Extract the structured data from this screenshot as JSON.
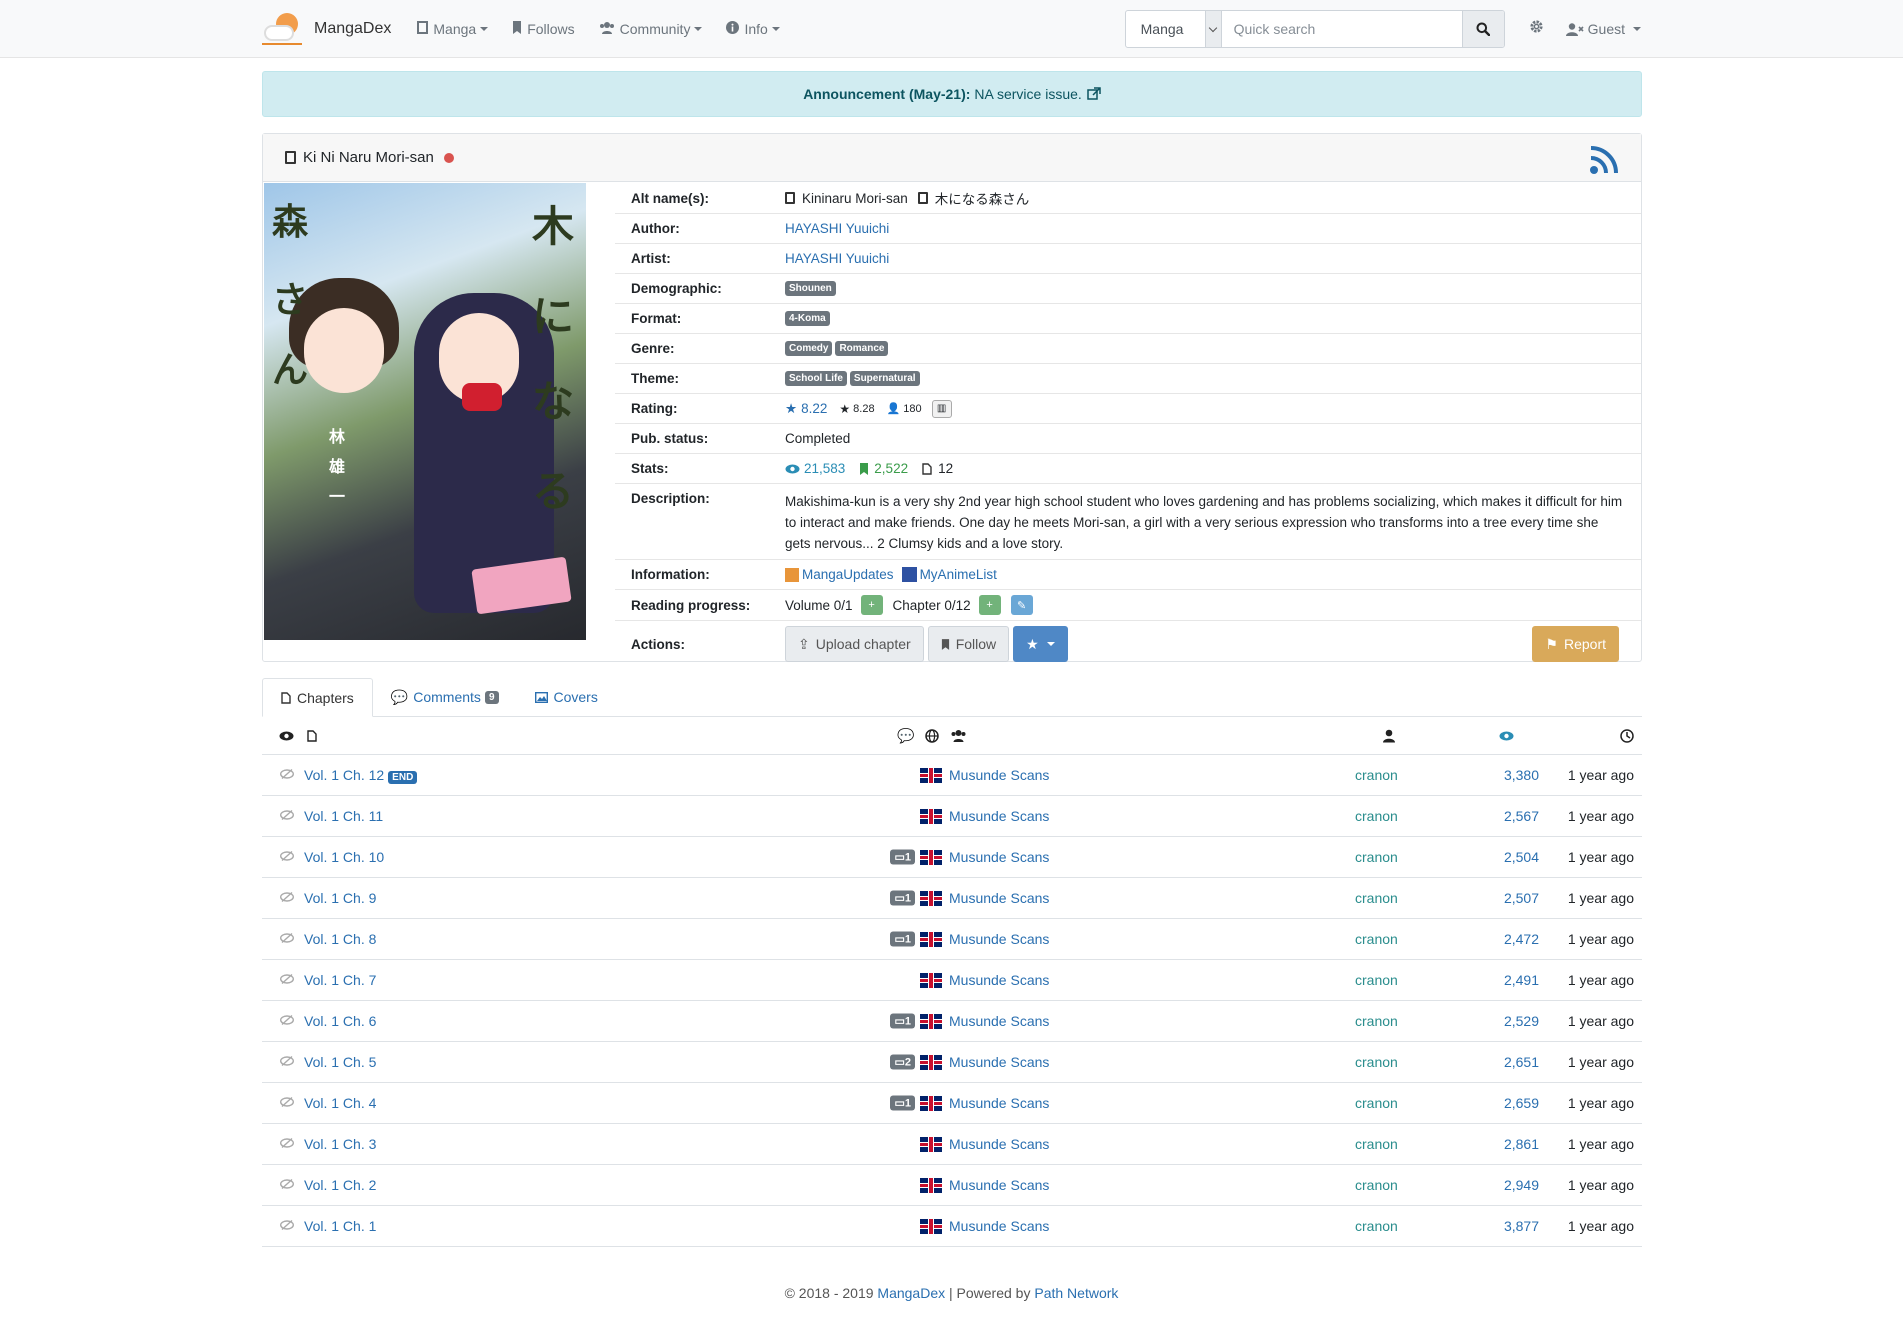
{
  "nav": {
    "brand": "MangaDex",
    "items": [
      {
        "label": "Manga",
        "icon": "book-icon",
        "dropdown": true
      },
      {
        "label": "Follows",
        "icon": "bookmark-icon",
        "dropdown": false
      },
      {
        "label": "Community",
        "icon": "users-icon",
        "dropdown": true
      },
      {
        "label": "Info",
        "icon": "info-icon",
        "dropdown": true
      }
    ],
    "search_type": "Manga",
    "search_placeholder": "Quick search",
    "user": "Guest"
  },
  "announcement": {
    "prefix": "Announcement (May-21):",
    "text": "NA service issue."
  },
  "manga": {
    "title": "Ki Ni Naru Mori-san",
    "status_color": "#d9534f",
    "labels": {
      "alt": "Alt name(s):",
      "author": "Author:",
      "artist": "Artist:",
      "demographic": "Demographic:",
      "format": "Format:",
      "genre": "Genre:",
      "theme": "Theme:",
      "rating": "Rating:",
      "pub_status": "Pub. status:",
      "stats": "Stats:",
      "description": "Description:",
      "information": "Information:",
      "reading_progress": "Reading progress:",
      "actions": "Actions:"
    },
    "alt_names": [
      "Kininaru Mori-san",
      "木になる森さん"
    ],
    "author": "HAYASHI Yuuichi",
    "artist": "HAYASHI Yuuichi",
    "demographic": [
      "Shounen"
    ],
    "format": [
      "4-Koma"
    ],
    "genre": [
      "Comedy",
      "Romance"
    ],
    "theme": [
      "School Life",
      "Supernatural"
    ],
    "rating": {
      "bayesian": "8.22",
      "mean": "8.28",
      "users": "180"
    },
    "pub_status": "Completed",
    "stats": {
      "views": "21,583",
      "follows": "2,522",
      "chapters": "12"
    },
    "description": "Makishima-kun is a very shy 2nd year high school student who loves gardening and has problems socializing, which makes it difficult for him to interact and make friends. One day he meets Mori-san, a girl with a very serious expression who transforms into a tree every time she gets nervous... 2 Clumsy kids and a love story.",
    "information": [
      "MangaUpdates",
      "MyAnimeList"
    ],
    "progress": {
      "volume": "Volume 0/1",
      "chapter": "Chapter 0/12"
    },
    "actions": {
      "upload": "Upload chapter",
      "follow": "Follow",
      "report": "Report"
    },
    "cover_text": {
      "kana_1": "木",
      "kana_2": "に",
      "kana_3": "な",
      "kana_4": "る",
      "kana_5": "森",
      "kana_6": "さ",
      "kana_7": "ん",
      "author_1": "林",
      "author_2": "雄",
      "author_3": "一"
    }
  },
  "tabs": [
    {
      "label": "Chapters",
      "count": null,
      "active": true
    },
    {
      "label": "Comments",
      "count": "9",
      "active": false
    },
    {
      "label": "Covers",
      "count": null,
      "active": false
    }
  ],
  "chapters": [
    {
      "title": "Vol. 1 Ch. 12",
      "end": "END",
      "comments": null,
      "group": "Musunde Scans",
      "uploader": "cranon",
      "views": "3,380",
      "age": "1 year ago"
    },
    {
      "title": "Vol. 1 Ch. 11",
      "end": null,
      "comments": null,
      "group": "Musunde Scans",
      "uploader": "cranon",
      "views": "2,567",
      "age": "1 year ago"
    },
    {
      "title": "Vol. 1 Ch. 10",
      "end": null,
      "comments": "1",
      "group": "Musunde Scans",
      "uploader": "cranon",
      "views": "2,504",
      "age": "1 year ago"
    },
    {
      "title": "Vol. 1 Ch. 9",
      "end": null,
      "comments": "1",
      "group": "Musunde Scans",
      "uploader": "cranon",
      "views": "2,507",
      "age": "1 year ago"
    },
    {
      "title": "Vol. 1 Ch. 8",
      "end": null,
      "comments": "1",
      "group": "Musunde Scans",
      "uploader": "cranon",
      "views": "2,472",
      "age": "1 year ago"
    },
    {
      "title": "Vol. 1 Ch. 7",
      "end": null,
      "comments": null,
      "group": "Musunde Scans",
      "uploader": "cranon",
      "views": "2,491",
      "age": "1 year ago"
    },
    {
      "title": "Vol. 1 Ch. 6",
      "end": null,
      "comments": "1",
      "group": "Musunde Scans",
      "uploader": "cranon",
      "views": "2,529",
      "age": "1 year ago"
    },
    {
      "title": "Vol. 1 Ch. 5",
      "end": null,
      "comments": "2",
      "group": "Musunde Scans",
      "uploader": "cranon",
      "views": "2,651",
      "age": "1 year ago"
    },
    {
      "title": "Vol. 1 Ch. 4",
      "end": null,
      "comments": "1",
      "group": "Musunde Scans",
      "uploader": "cranon",
      "views": "2,659",
      "age": "1 year ago"
    },
    {
      "title": "Vol. 1 Ch. 3",
      "end": null,
      "comments": null,
      "group": "Musunde Scans",
      "uploader": "cranon",
      "views": "2,861",
      "age": "1 year ago"
    },
    {
      "title": "Vol. 1 Ch. 2",
      "end": null,
      "comments": null,
      "group": "Musunde Scans",
      "uploader": "cranon",
      "views": "2,949",
      "age": "1 year ago"
    },
    {
      "title": "Vol. 1 Ch. 1",
      "end": null,
      "comments": null,
      "group": "Musunde Scans",
      "uploader": "cranon",
      "views": "3,877",
      "age": "1 year ago"
    }
  ],
  "footer": {
    "prefix": "© 2018 - 2019",
    "site": "MangaDex",
    "separator": "| Powered by",
    "host": "Path Network"
  }
}
